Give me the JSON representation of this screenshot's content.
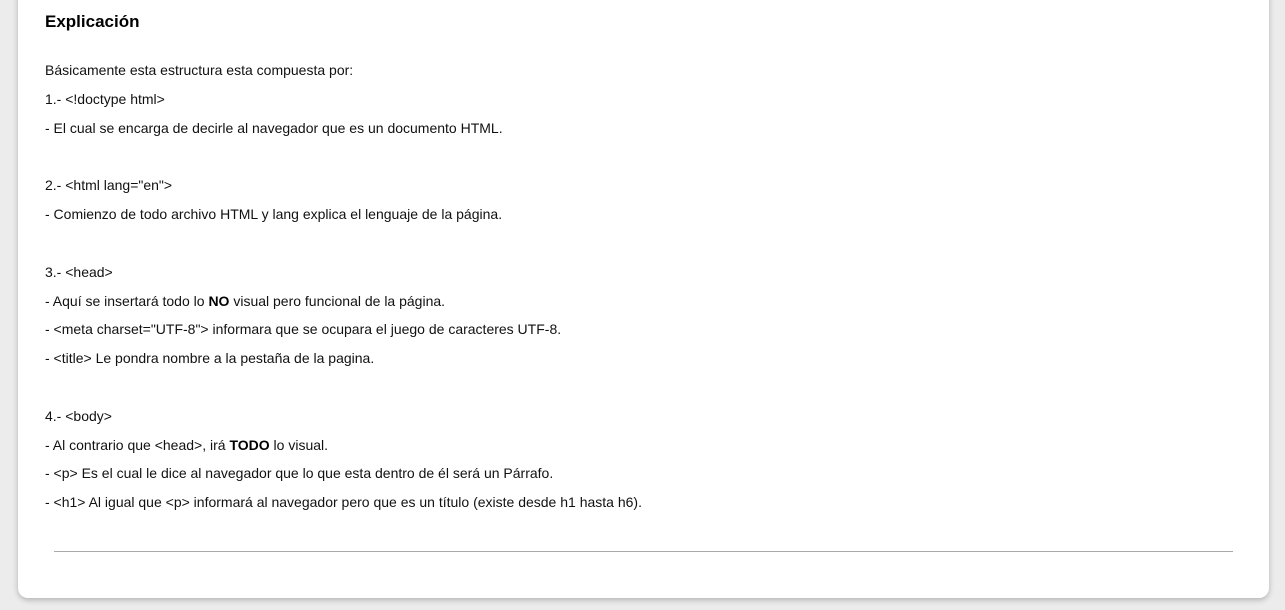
{
  "section": {
    "title": "Explicación",
    "intro": "Básicamente esta estructura esta compuesta por:",
    "item1_heading": "1.- <!doctype html>",
    "item1_desc": "- El cual se encarga de decirle al navegador que es un documento HTML.",
    "item2_heading": "2.- <html lang=\"en\">",
    "item2_desc": "- Comienzo de todo archivo HTML y lang explica el lenguaje de la página.",
    "item3_heading": "3.- <head>",
    "item3_desc1_pre": "- Aquí se insertará todo lo ",
    "item3_desc1_bold": "NO",
    "item3_desc1_post": " visual pero funcional de la página.",
    "item3_desc2": "- <meta charset=\"UTF-8\"> informara que se ocupara el juego de caracteres UTF-8.",
    "item3_desc3": "- <title> Le pondra nombre a la pestaña de la pagina.",
    "item4_heading": "4.- <body>",
    "item4_desc1_pre": "- Al contrario que <head>, irá ",
    "item4_desc1_bold": "TODO",
    "item4_desc1_post": " lo visual.",
    "item4_desc2": "- <p> Es el cual le dice al navegador que lo que esta dentro de él será un Párrafo.",
    "item4_desc3": "- <h1> Al igual que <p> informará al navegador pero que es un título (existe desde h1 hasta h6)."
  }
}
